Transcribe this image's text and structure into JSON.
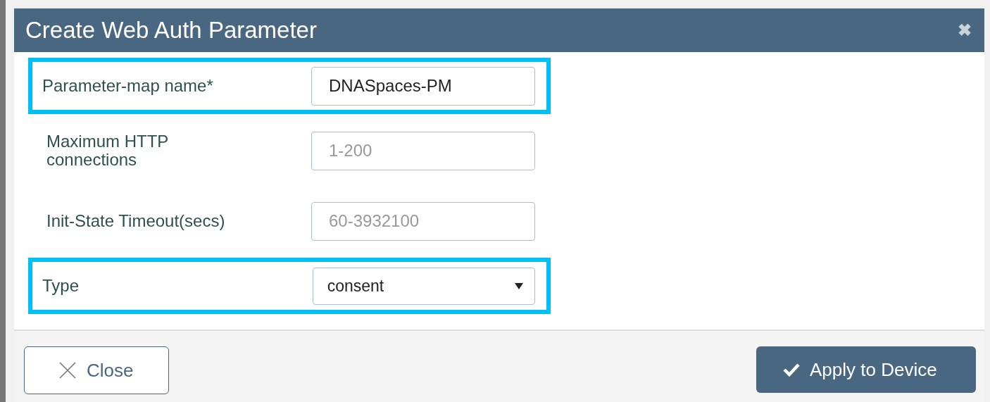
{
  "dialog": {
    "title": "Create Web Auth Parameter",
    "close_icon": "✖"
  },
  "fields": [
    {
      "kind": "text",
      "label": "Parameter-map name*",
      "value": "DNASpaces-PM",
      "highlighted": true
    },
    {
      "kind": "text",
      "label": "Maximum HTTP connections",
      "placeholder": "1-200",
      "highlighted": false
    },
    {
      "kind": "text",
      "label": "Init-State Timeout(secs)",
      "placeholder": "60-3932100",
      "highlighted": false
    },
    {
      "kind": "select",
      "label": "Type",
      "value": "consent",
      "highlighted": true
    }
  ],
  "buttons": [
    {
      "kind": "close",
      "label": "Close"
    },
    {
      "kind": "apply",
      "label": "Apply to Device"
    }
  ]
}
